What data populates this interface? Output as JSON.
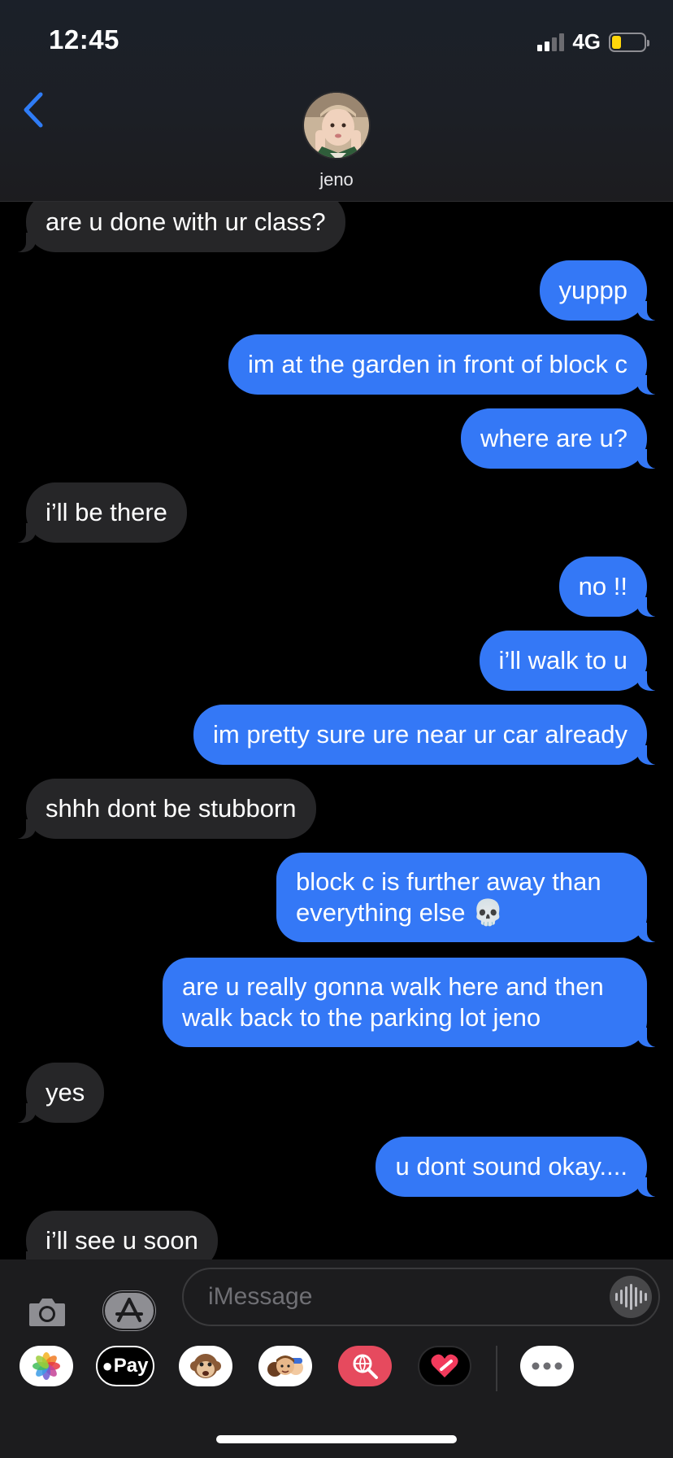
{
  "status_bar": {
    "time": "12:45",
    "network": "4G"
  },
  "contact": {
    "name": "jeno"
  },
  "messages": [
    {
      "dir": "in",
      "text": "are u done with ur class?"
    },
    {
      "dir": "out",
      "text": "yuppp"
    },
    {
      "dir": "out",
      "text": "im at the garden in front of block c"
    },
    {
      "dir": "out",
      "text": "where are u?"
    },
    {
      "dir": "in",
      "text": "i’ll be there"
    },
    {
      "dir": "out",
      "text": "no !!"
    },
    {
      "dir": "out",
      "text": "i’ll walk to u"
    },
    {
      "dir": "out",
      "text": "im pretty sure ure near ur car already"
    },
    {
      "dir": "in",
      "text": "shhh dont be stubborn"
    },
    {
      "dir": "out",
      "lines": [
        "block c is further away than",
        "everything else 💀"
      ]
    },
    {
      "dir": "out",
      "lines": [
        "are u really gonna walk here and then",
        "walk back to the parking lot jeno"
      ]
    },
    {
      "dir": "in",
      "text": "yes"
    },
    {
      "dir": "out",
      "text": "u dont sound okay...."
    },
    {
      "dir": "in",
      "text": "i’ll see u soon"
    }
  ],
  "composer": {
    "placeholder": "iMessage"
  },
  "app_drawer": {
    "items": [
      {
        "name": "photos",
        "icon": "photos-icon"
      },
      {
        "name": "apple-pay",
        "label": "Pay",
        "icon": "apple-pay-icon"
      },
      {
        "name": "animoji",
        "icon": "monkey-icon"
      },
      {
        "name": "memoji",
        "icon": "memoji-icon"
      },
      {
        "name": "image-search",
        "icon": "search-globe-icon"
      },
      {
        "name": "digital-touch",
        "icon": "heart-icon"
      },
      {
        "name": "more",
        "icon": "more-icon"
      }
    ]
  },
  "colors": {
    "outgoing": "#3478f6",
    "incoming": "#262628",
    "accent": "#2f7cf6"
  }
}
